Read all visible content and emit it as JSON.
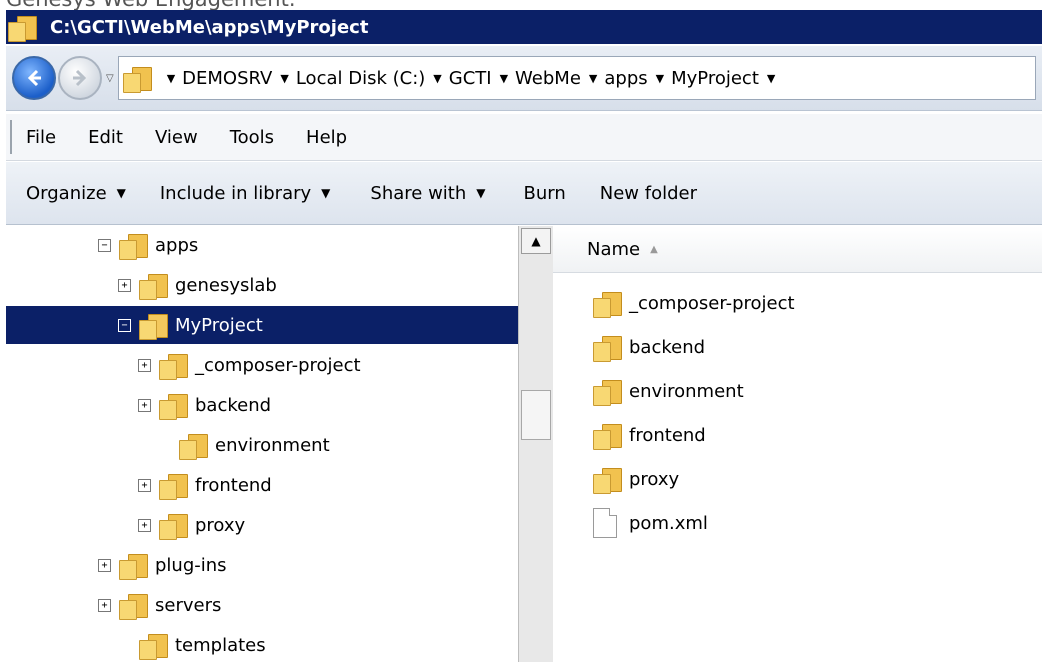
{
  "page": {
    "heading": "Genesys Web Engagement."
  },
  "window": {
    "title": "C:\\GCTI\\WebMe\\apps\\MyProject"
  },
  "address": {
    "breadcrumbs": [
      "DEMOSRV",
      "Local Disk (C:)",
      "GCTI",
      "WebMe",
      "apps",
      "MyProject"
    ]
  },
  "menu": {
    "items": [
      "File",
      "Edit",
      "View",
      "Tools",
      "Help"
    ]
  },
  "toolbar": {
    "organize": "Organize",
    "include_in_library": "Include in library",
    "share_with": "Share with",
    "burn": "Burn",
    "new_folder": "New folder"
  },
  "tree": {
    "items": [
      {
        "label": "apps",
        "expander": "−",
        "selected": false
      },
      {
        "label": "genesyslab",
        "expander": "+",
        "selected": false
      },
      {
        "label": "MyProject",
        "expander": "−",
        "selected": true
      },
      {
        "label": "_composer-project",
        "expander": "+",
        "selected": false
      },
      {
        "label": "backend",
        "expander": "+",
        "selected": false
      },
      {
        "label": "environment",
        "expander": "",
        "selected": false
      },
      {
        "label": "frontend",
        "expander": "+",
        "selected": false
      },
      {
        "label": "proxy",
        "expander": "+",
        "selected": false
      },
      {
        "label": "plug-ins",
        "expander": "+",
        "selected": false
      },
      {
        "label": "servers",
        "expander": "+",
        "selected": false
      },
      {
        "label": "templates",
        "expander": "",
        "selected": false
      }
    ]
  },
  "content": {
    "column_header": "Name",
    "items": [
      {
        "name": "_composer-project",
        "type": "folder-icon"
      },
      {
        "name": "backend",
        "type": "folder-icon"
      },
      {
        "name": "environment",
        "type": "folder-icon"
      },
      {
        "name": "frontend",
        "type": "folder-icon"
      },
      {
        "name": "proxy",
        "type": "folder-icon"
      },
      {
        "name": "pom.xml",
        "type": "file-icon"
      }
    ]
  }
}
